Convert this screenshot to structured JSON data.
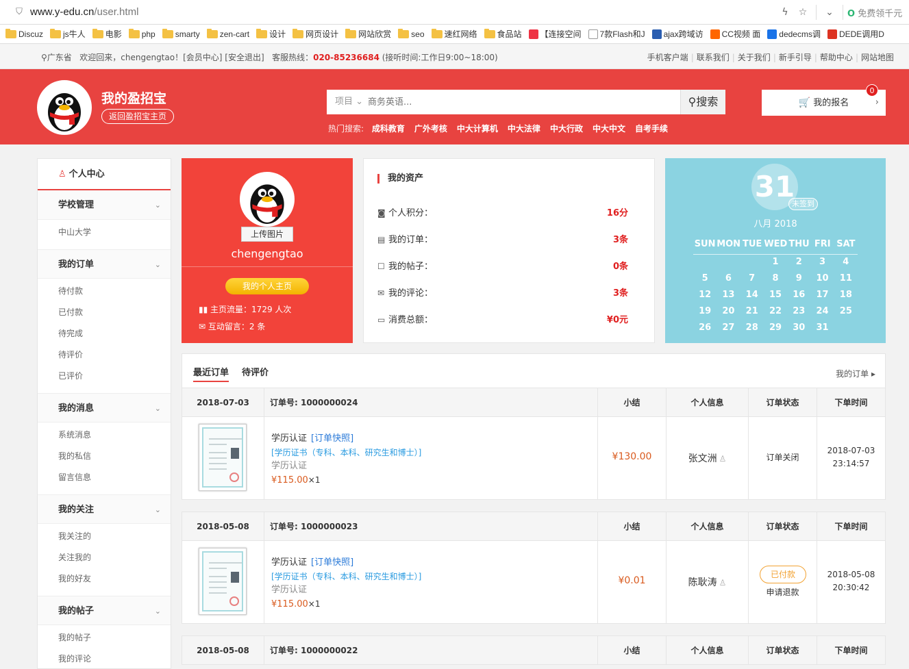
{
  "browser": {
    "url_host": "www.y-edu.cn",
    "url_path": "/user.html",
    "free_text": "免费领千元",
    "bookmarks": [
      "Discuz",
      "js牛人",
      "电影",
      "php",
      "smarty",
      "zen-cart",
      "设计",
      "网页设计",
      "网站欣赏",
      "seo",
      "速红网络",
      "食品站",
      "【连接空间",
      "7款Flash和J",
      "ajax跨域访",
      "CC视频 面",
      "dedecms调",
      "DEDE调用D"
    ]
  },
  "topbar": {
    "location": "广东省",
    "welcome": "欢迎回来，chengengtao！[会员中心] [安全退出]",
    "hotline_label": "客服热线：",
    "hotline": "020-85236684",
    "hours": "(接听时间:工作日9:00~18:00)",
    "links": [
      "手机客户端",
      "联系我们",
      "关于我们",
      "新手引导",
      "帮助中心",
      "网站地图"
    ]
  },
  "header": {
    "brand": "我的盈招宝",
    "back_link": "返回盈招宝主页",
    "search_category": "项目",
    "search_placeholder": "商务英语...",
    "search_button": "搜索",
    "hot_label": "热门搜索:",
    "hot_keywords": [
      "成科教育",
      "广外考核",
      "中大计算机",
      "中大法律",
      "中大行政",
      "中大中文",
      "自考手续"
    ],
    "signup_label": "我的报名",
    "cart_count": "0"
  },
  "sidebar": {
    "title": "个人中心",
    "groups": [
      {
        "label": "学校管理",
        "items": [
          "中山大学"
        ]
      },
      {
        "label": "我的订单",
        "items": [
          "待付款",
          "已付款",
          "待完成",
          "待评价",
          "已评价"
        ]
      },
      {
        "label": "我的消息",
        "items": [
          "系统消息",
          "我的私信",
          "留言信息"
        ]
      },
      {
        "label": "我的关注",
        "items": [
          "我关注的",
          "关注我的",
          "我的好友"
        ]
      },
      {
        "label": "我的帖子",
        "items": [
          "我的帖子",
          "我的评论"
        ]
      }
    ]
  },
  "profile": {
    "upload": "上传图片",
    "username": "chengengtao",
    "home_button": "我的个人主页",
    "traffic": "主页流量：1729 人次",
    "messages": "互动留言：2 条"
  },
  "assets": {
    "title": "我的资产",
    "rows": [
      {
        "label": "个人积分：",
        "value": "16分"
      },
      {
        "label": "我的订单：",
        "value": "3条"
      },
      {
        "label": "我的帖子：",
        "value": "0条"
      },
      {
        "label": "我的评论：",
        "value": "3条"
      },
      {
        "label": "消费总额：",
        "value": "¥0元"
      }
    ]
  },
  "calendar": {
    "day": "31",
    "unsigned": "未签到",
    "month": "八月 2018",
    "weekdays": [
      "SUN",
      "MON",
      "TUE",
      "WED",
      "THU",
      "FRI",
      "SAT"
    ],
    "weeks": [
      [
        "",
        "",
        "",
        "1",
        "2",
        "3",
        "4"
      ],
      [
        "5",
        "6",
        "7",
        "8",
        "9",
        "10",
        "11"
      ],
      [
        "12",
        "13",
        "14",
        "15",
        "16",
        "17",
        "18"
      ],
      [
        "19",
        "20",
        "21",
        "22",
        "23",
        "24",
        "25"
      ],
      [
        "26",
        "27",
        "28",
        "29",
        "30",
        "31",
        ""
      ]
    ]
  },
  "orders": {
    "tabs": [
      "最近订单",
      "待评价"
    ],
    "more": "我的订单",
    "headers": {
      "subtotal": "小结",
      "person": "个人信息",
      "status": "订单状态",
      "time": "下单时间"
    },
    "list": [
      {
        "date": "2018-07-03",
        "order_no": "订单号: 1000000024",
        "product": "学历认证",
        "snapshot": "[订单快照]",
        "spec": "[学历证书（专科、本科、研究生和博士）]",
        "category": "学历认证",
        "price": "¥115.00",
        "qty": "×1",
        "subtotal": "¥130.00",
        "person": "张文洲",
        "status": "订单关闭",
        "status_sub": "",
        "badge": "",
        "time_date": "2018-07-03",
        "time_clock": "23:14:57"
      },
      {
        "date": "2018-05-08",
        "order_no": "订单号: 1000000023",
        "product": "学历认证",
        "snapshot": "[订单快照]",
        "spec": "[学历证书（专科、本科、研究生和博士）]",
        "category": "学历认证",
        "price": "¥115.00",
        "qty": "×1",
        "subtotal": "¥0.01",
        "person": "陈耿涛",
        "status": "",
        "status_sub": "申请退款",
        "badge": "已付款",
        "time_date": "2018-05-08",
        "time_clock": "20:30:42"
      },
      {
        "date": "2018-05-08",
        "order_no": "订单号: 1000000022"
      }
    ]
  }
}
